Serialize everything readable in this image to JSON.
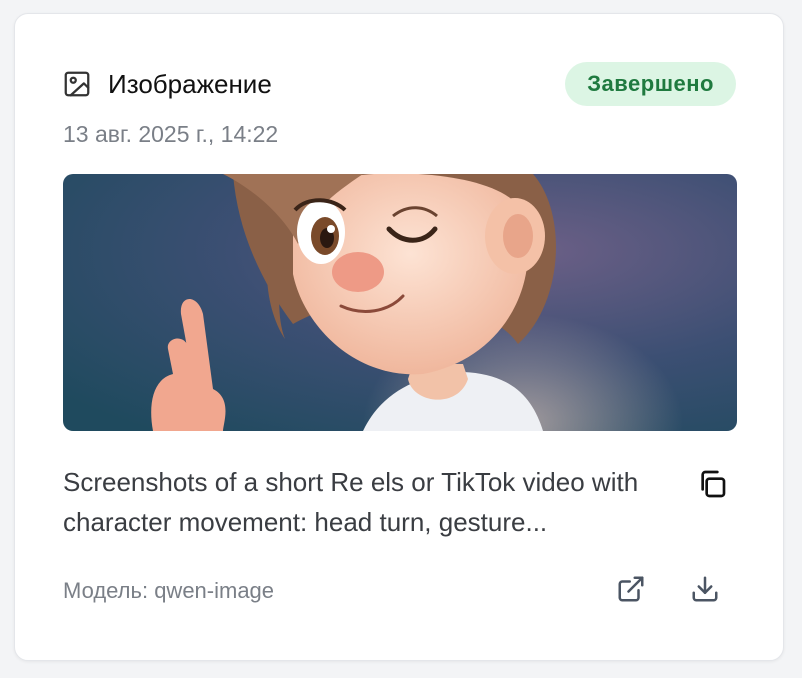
{
  "card": {
    "type_label": "Изображение",
    "status": "Завершено",
    "date": "13 авг. 2025 г., 14:22",
    "description": "Screenshots of a short Re els or TikTok video with character movement: head turn, gesture...",
    "model_label": "Модель: qwen-image"
  },
  "icons": {
    "type": "image-icon",
    "copy": "copy-icon",
    "open": "external-link-icon",
    "download": "download-icon"
  },
  "colors": {
    "status_bg": "#dcf5e4",
    "status_text": "#1f7a3f",
    "icon": "#4b5563"
  }
}
